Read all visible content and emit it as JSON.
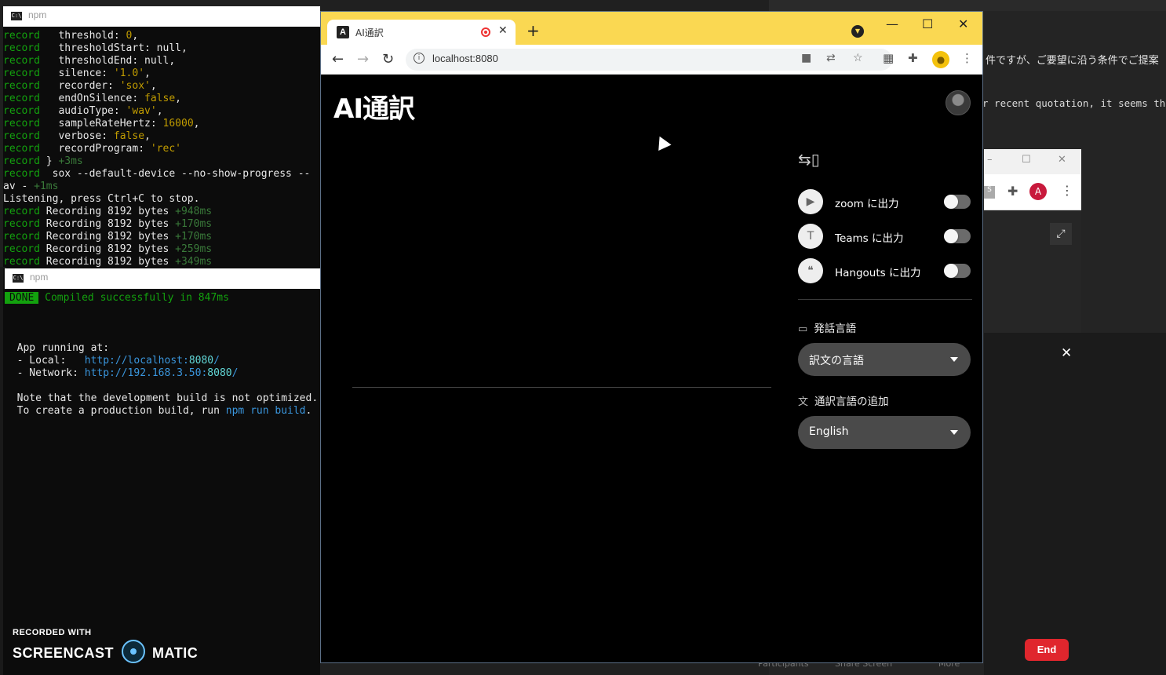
{
  "background": {
    "jp_text": "件ですが、ご要望に沿う条件でご提案",
    "quote_text": "r recent quotation, it seems th",
    "bg_browser_avatar": "A",
    "end_button": "End",
    "bottom_items": [
      "Participants",
      "Share Screen",
      "More"
    ]
  },
  "terminal1": {
    "title": "npm",
    "lines": [
      [
        [
          "g",
          "record"
        ],
        [
          "w",
          "   threshold: "
        ],
        [
          "y",
          "0"
        ],
        [
          "w",
          ","
        ]
      ],
      [
        [
          "g",
          "record"
        ],
        [
          "w",
          "   thresholdStart: null,"
        ]
      ],
      [
        [
          "g",
          "record"
        ],
        [
          "w",
          "   thresholdEnd: null,"
        ]
      ],
      [
        [
          "g",
          "record"
        ],
        [
          "w",
          "   silence: "
        ],
        [
          "y",
          "'1.0'"
        ],
        [
          "w",
          ","
        ]
      ],
      [
        [
          "g",
          "record"
        ],
        [
          "w",
          "   recorder: "
        ],
        [
          "y",
          "'sox'"
        ],
        [
          "w",
          ","
        ]
      ],
      [
        [
          "g",
          "record"
        ],
        [
          "w",
          "   endOnSilence: "
        ],
        [
          "y",
          "false"
        ],
        [
          "w",
          ","
        ]
      ],
      [
        [
          "g",
          "record"
        ],
        [
          "w",
          "   audioType: "
        ],
        [
          "y",
          "'wav'"
        ],
        [
          "w",
          ","
        ]
      ],
      [
        [
          "g",
          "record"
        ],
        [
          "w",
          "   sampleRateHertz: "
        ],
        [
          "y",
          "16000"
        ],
        [
          "w",
          ","
        ]
      ],
      [
        [
          "g",
          "record"
        ],
        [
          "w",
          "   verbose: "
        ],
        [
          "y",
          "false"
        ],
        [
          "w",
          ","
        ]
      ],
      [
        [
          "g",
          "record"
        ],
        [
          "w",
          "   recordProgram: "
        ],
        [
          "y",
          "'rec'"
        ]
      ],
      [
        [
          "g",
          "record"
        ],
        [
          "w",
          " } "
        ],
        [
          "d",
          "+3ms"
        ]
      ],
      [
        [
          "g",
          "record"
        ],
        [
          "w",
          "  sox --default-device --no-show-progress --"
        ]
      ],
      [
        [
          "w",
          "av - "
        ],
        [
          "d",
          "+1ms"
        ]
      ],
      [
        [
          "w",
          "Listening, press Ctrl+C to stop."
        ]
      ],
      [
        [
          "g",
          "record"
        ],
        [
          "w",
          " Recording 8192 bytes "
        ],
        [
          "d",
          "+948ms"
        ]
      ],
      [
        [
          "g",
          "record"
        ],
        [
          "w",
          " Recording 8192 bytes "
        ],
        [
          "d",
          "+170ms"
        ]
      ],
      [
        [
          "g",
          "record"
        ],
        [
          "w",
          " Recording 8192 bytes "
        ],
        [
          "d",
          "+170ms"
        ]
      ],
      [
        [
          "g",
          "record"
        ],
        [
          "w",
          " Recording 8192 bytes "
        ],
        [
          "d",
          "+259ms"
        ]
      ],
      [
        [
          "g",
          "record"
        ],
        [
          "w",
          " Recording 8192 bytes "
        ],
        [
          "d",
          "+349ms"
        ]
      ]
    ]
  },
  "terminal2": {
    "title": "npm",
    "done_badge": "DONE",
    "compiled": " Compiled successfully in 847ms",
    "app_running": "  App running at:",
    "local_label": "  - Local:   ",
    "local_url": "http://localhost:",
    "local_port": "8080",
    "network_label": "  - Network: ",
    "network_url": "http://192.168.3.50:",
    "network_port": "8080",
    "note1": "  Note that the development build is not optimized.",
    "note2_a": "  To create a production build, run ",
    "note2_b": "npm run build",
    "note2_c": "."
  },
  "watermark": {
    "recorded_with": "RECORDED WITH",
    "brand_a": "SCREENCAST",
    "brand_b": "MATIC"
  },
  "browser": {
    "tab_title": "AI通訳",
    "favicon_letter": "A",
    "url": "localhost:8080",
    "accent": "#fad852"
  },
  "app": {
    "title": "AI通訳",
    "outputs": [
      {
        "label": "zoom に出力",
        "icon": "video-icon",
        "on": false
      },
      {
        "label": "Teams に出力",
        "icon": "teams-icon",
        "on": false
      },
      {
        "label": "Hangouts に出力",
        "icon": "hangouts-icon",
        "on": false
      }
    ],
    "speech_lang_heading": "発話言語",
    "speech_lang_value": "訳文の言語",
    "add_lang_heading": "通訳言語の追加",
    "add_lang_value": "English"
  }
}
